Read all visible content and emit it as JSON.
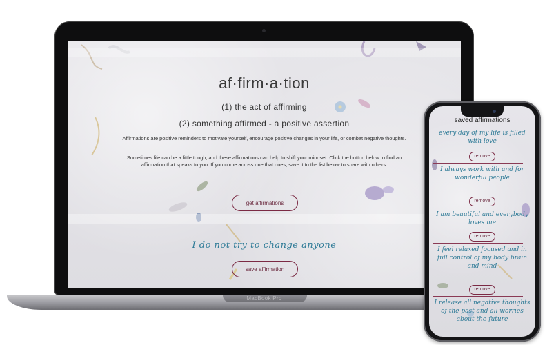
{
  "laptop": {
    "brand_label": "MacBook Pro"
  },
  "page": {
    "title": "af·firm·a·tion",
    "definition_1": "(1) the act of affirming",
    "definition_2": "(2) something affirmed - a positive assertion",
    "paragraph_1": "Affirmations are positive reminders to motivate yourself, encourage positive changes in your life, or combat negative thoughts.",
    "paragraph_2": "Sometimes life can be a little tough, and these affirmations can help to shift your mindset. Click the button below to find an affirmation that speaks to you. If you come across one that does, save it to the list below to share with others.",
    "get_button": "get affirmations",
    "current_affirmation": "I do not try to change anyone",
    "save_button": "save affirmation"
  },
  "phone": {
    "saved_title": "saved affirmations",
    "remove_label": "remove",
    "items": [
      {
        "text": "every day of my life is filled with love"
      },
      {
        "text": "I always work with and for wonderful people"
      },
      {
        "text": "I am beautiful and everybody loves me"
      },
      {
        "text": "I feel relaxed focused and in full control of my body brain and mind"
      },
      {
        "text": "I release all negative thoughts of the past and all worries about the future"
      }
    ]
  },
  "colors": {
    "accent_teal": "#2f7b97",
    "button_border": "#7b2a44",
    "device_frame": "#141416"
  }
}
